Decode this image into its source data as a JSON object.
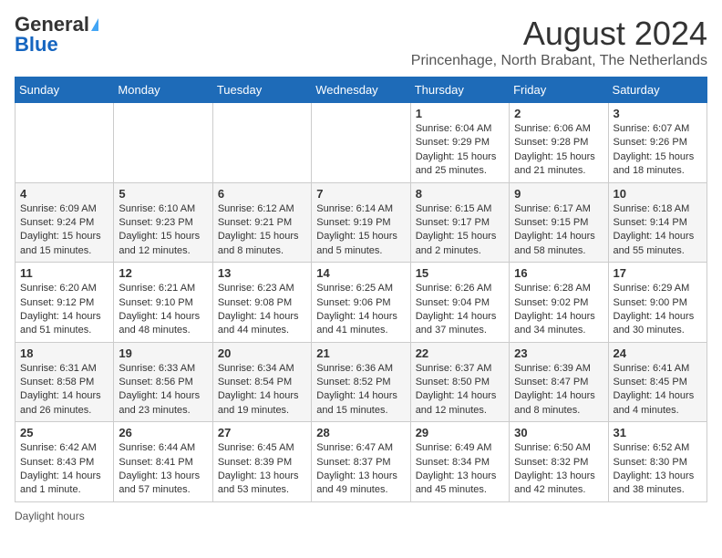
{
  "header": {
    "logo_general": "General",
    "logo_blue": "Blue",
    "month_year": "August 2024",
    "location": "Princenhage, North Brabant, The Netherlands"
  },
  "days_of_week": [
    "Sunday",
    "Monday",
    "Tuesday",
    "Wednesday",
    "Thursday",
    "Friday",
    "Saturday"
  ],
  "weeks": [
    [
      {
        "day": "",
        "info": ""
      },
      {
        "day": "",
        "info": ""
      },
      {
        "day": "",
        "info": ""
      },
      {
        "day": "",
        "info": ""
      },
      {
        "day": "1",
        "info": "Sunrise: 6:04 AM\nSunset: 9:29 PM\nDaylight: 15 hours and 25 minutes."
      },
      {
        "day": "2",
        "info": "Sunrise: 6:06 AM\nSunset: 9:28 PM\nDaylight: 15 hours and 21 minutes."
      },
      {
        "day": "3",
        "info": "Sunrise: 6:07 AM\nSunset: 9:26 PM\nDaylight: 15 hours and 18 minutes."
      }
    ],
    [
      {
        "day": "4",
        "info": "Sunrise: 6:09 AM\nSunset: 9:24 PM\nDaylight: 15 hours and 15 minutes."
      },
      {
        "day": "5",
        "info": "Sunrise: 6:10 AM\nSunset: 9:23 PM\nDaylight: 15 hours and 12 minutes."
      },
      {
        "day": "6",
        "info": "Sunrise: 6:12 AM\nSunset: 9:21 PM\nDaylight: 15 hours and 8 minutes."
      },
      {
        "day": "7",
        "info": "Sunrise: 6:14 AM\nSunset: 9:19 PM\nDaylight: 15 hours and 5 minutes."
      },
      {
        "day": "8",
        "info": "Sunrise: 6:15 AM\nSunset: 9:17 PM\nDaylight: 15 hours and 2 minutes."
      },
      {
        "day": "9",
        "info": "Sunrise: 6:17 AM\nSunset: 9:15 PM\nDaylight: 14 hours and 58 minutes."
      },
      {
        "day": "10",
        "info": "Sunrise: 6:18 AM\nSunset: 9:14 PM\nDaylight: 14 hours and 55 minutes."
      }
    ],
    [
      {
        "day": "11",
        "info": "Sunrise: 6:20 AM\nSunset: 9:12 PM\nDaylight: 14 hours and 51 minutes."
      },
      {
        "day": "12",
        "info": "Sunrise: 6:21 AM\nSunset: 9:10 PM\nDaylight: 14 hours and 48 minutes."
      },
      {
        "day": "13",
        "info": "Sunrise: 6:23 AM\nSunset: 9:08 PM\nDaylight: 14 hours and 44 minutes."
      },
      {
        "day": "14",
        "info": "Sunrise: 6:25 AM\nSunset: 9:06 PM\nDaylight: 14 hours and 41 minutes."
      },
      {
        "day": "15",
        "info": "Sunrise: 6:26 AM\nSunset: 9:04 PM\nDaylight: 14 hours and 37 minutes."
      },
      {
        "day": "16",
        "info": "Sunrise: 6:28 AM\nSunset: 9:02 PM\nDaylight: 14 hours and 34 minutes."
      },
      {
        "day": "17",
        "info": "Sunrise: 6:29 AM\nSunset: 9:00 PM\nDaylight: 14 hours and 30 minutes."
      }
    ],
    [
      {
        "day": "18",
        "info": "Sunrise: 6:31 AM\nSunset: 8:58 PM\nDaylight: 14 hours and 26 minutes."
      },
      {
        "day": "19",
        "info": "Sunrise: 6:33 AM\nSunset: 8:56 PM\nDaylight: 14 hours and 23 minutes."
      },
      {
        "day": "20",
        "info": "Sunrise: 6:34 AM\nSunset: 8:54 PM\nDaylight: 14 hours and 19 minutes."
      },
      {
        "day": "21",
        "info": "Sunrise: 6:36 AM\nSunset: 8:52 PM\nDaylight: 14 hours and 15 minutes."
      },
      {
        "day": "22",
        "info": "Sunrise: 6:37 AM\nSunset: 8:50 PM\nDaylight: 14 hours and 12 minutes."
      },
      {
        "day": "23",
        "info": "Sunrise: 6:39 AM\nSunset: 8:47 PM\nDaylight: 14 hours and 8 minutes."
      },
      {
        "day": "24",
        "info": "Sunrise: 6:41 AM\nSunset: 8:45 PM\nDaylight: 14 hours and 4 minutes."
      }
    ],
    [
      {
        "day": "25",
        "info": "Sunrise: 6:42 AM\nSunset: 8:43 PM\nDaylight: 14 hours and 1 minute."
      },
      {
        "day": "26",
        "info": "Sunrise: 6:44 AM\nSunset: 8:41 PM\nDaylight: 13 hours and 57 minutes."
      },
      {
        "day": "27",
        "info": "Sunrise: 6:45 AM\nSunset: 8:39 PM\nDaylight: 13 hours and 53 minutes."
      },
      {
        "day": "28",
        "info": "Sunrise: 6:47 AM\nSunset: 8:37 PM\nDaylight: 13 hours and 49 minutes."
      },
      {
        "day": "29",
        "info": "Sunrise: 6:49 AM\nSunset: 8:34 PM\nDaylight: 13 hours and 45 minutes."
      },
      {
        "day": "30",
        "info": "Sunrise: 6:50 AM\nSunset: 8:32 PM\nDaylight: 13 hours and 42 minutes."
      },
      {
        "day": "31",
        "info": "Sunrise: 6:52 AM\nSunset: 8:30 PM\nDaylight: 13 hours and 38 minutes."
      }
    ]
  ],
  "footer": {
    "note": "Daylight hours"
  }
}
